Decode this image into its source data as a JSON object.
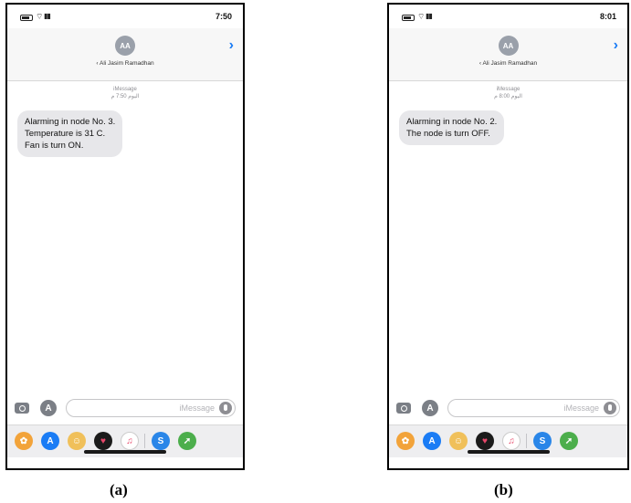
{
  "screens": [
    {
      "status_time": "7:50",
      "avatar_initials": "AA",
      "contact_name": "‹ Ali Jasim Ramadhan",
      "service_label": "iMessage",
      "timestamp": "اليوم 7:50 م",
      "message_lines": [
        "Alarming in node No. 3.",
        "Temperature is 31 C.",
        "Fan is turn ON."
      ],
      "input_placeholder": "iMessage",
      "caption": "(a)"
    },
    {
      "status_time": "8:01",
      "avatar_initials": "AA",
      "contact_name": "‹ Ali Jasim Ramadhan",
      "service_label": "iMessage",
      "timestamp": "اليوم 8:00 م",
      "message_lines": [
        "Alarming in node No. 2.",
        "The node is turn OFF."
      ],
      "input_placeholder": "iMessage",
      "caption": "(b)"
    }
  ],
  "icons": {
    "chevron": "chevron-right-icon",
    "camera": "camera-icon",
    "appstore": "appstore-icon",
    "mic": "mic-icon"
  },
  "colors": {
    "accent_blue": "#1a7cf5",
    "bubble_gray": "#e7e7ea",
    "avatar_gray": "#9aa0aa"
  }
}
